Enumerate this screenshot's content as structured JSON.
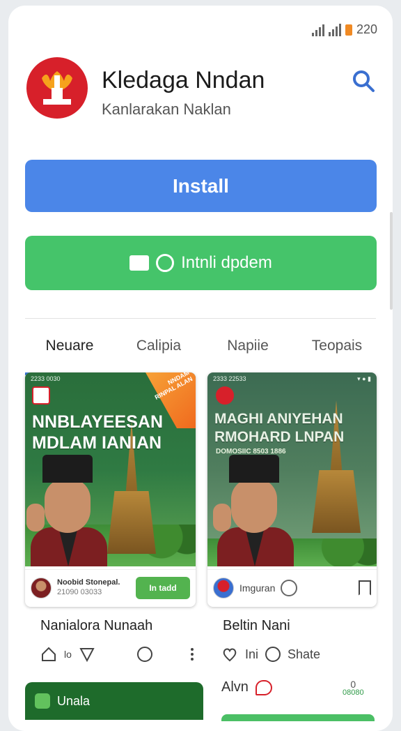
{
  "status_bar": {
    "time": "220"
  },
  "app": {
    "title": "Kledaga Nndan",
    "subtitle": "Kanlarakan Naklan"
  },
  "buttons": {
    "install": "Install",
    "secondary": "Intnli dpdem"
  },
  "tabs": [
    {
      "label": "Neuare",
      "active": true
    },
    {
      "label": "Calipia",
      "active": false
    },
    {
      "label": "Napiie",
      "active": false
    },
    {
      "label": "Teopais",
      "active": false
    }
  ],
  "cards": [
    {
      "status_time": "2233 0030",
      "promo_text": "NNDAM RINPAL ALAN",
      "headline_1": "NNBLAYEESAN",
      "headline_2": "MDLAM IANIAN",
      "meta_name": "Noobid Stonepal.",
      "meta_date": "21090 03033",
      "meta_button": "In tadd",
      "title": "Nanialora Nunaah",
      "action_count": "lo",
      "bottom_label": "Unala"
    },
    {
      "status_time": "2333 22533",
      "headline_1": "MAGHI ANIYEHAN",
      "headline_2": "RMOHARD LNPAN",
      "tagline": "DOMOSIIC 8503 1886",
      "meta_name": "Imguran",
      "title": "Beltin Nani",
      "action_count": "Ini",
      "action_share": "Shate",
      "alvin": "Alvn",
      "small_stat_top": "0",
      "small_stat_bottom": "08080"
    }
  ],
  "colors": {
    "install_blue": "#4b86e8",
    "secondary_green": "#45c46a",
    "brand_red": "#d7202a",
    "tab_underline": "#3a78d8"
  }
}
